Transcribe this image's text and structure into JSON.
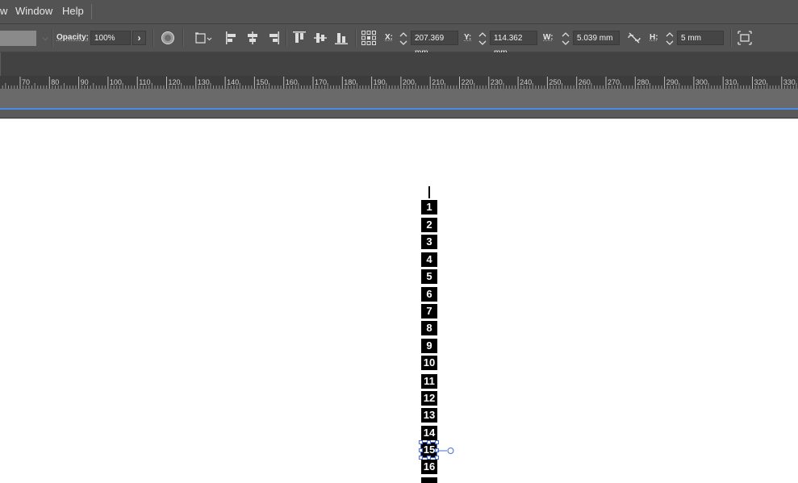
{
  "menu": {
    "items": [
      {
        "label": "w"
      },
      {
        "label": "Window"
      },
      {
        "label": "Help"
      }
    ]
  },
  "control": {
    "opacity_label": "Opacity:",
    "opacity_value": "100%",
    "x_label": "X:",
    "x_value": "207.369 mm",
    "y_label": "Y:",
    "y_value": "114.362 mm",
    "w_label": "W:",
    "w_value": "5.039 mm",
    "h_label": "H:",
    "h_value": "5 mm",
    "arrow": "›"
  },
  "ruler": {
    "ticks": [
      "70",
      "80",
      "90",
      "100",
      "110",
      "120",
      "130",
      "140",
      "150",
      "160",
      "170",
      "180",
      "190",
      "200",
      "210",
      "220",
      "230",
      "240",
      "250",
      "260",
      "270",
      "280",
      "290",
      "300",
      "310",
      "320",
      "330"
    ]
  },
  "document": {
    "cells": [
      "1",
      "2",
      "3",
      "4",
      "5",
      "6",
      "7",
      "8",
      "9",
      "10",
      "11",
      "12",
      "13",
      "14",
      "15",
      "16"
    ]
  }
}
